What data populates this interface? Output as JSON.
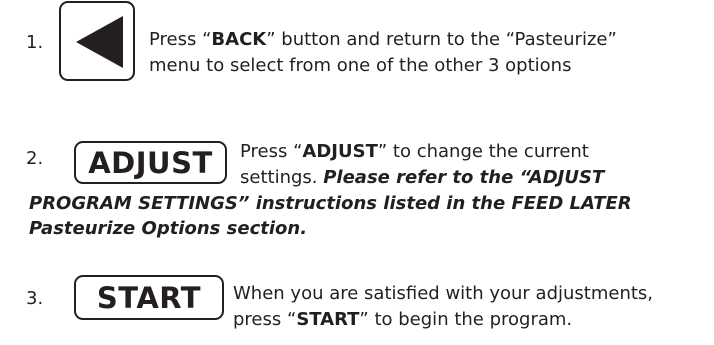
{
  "steps": [
    {
      "number": "1.",
      "button": {
        "icon": "back-triangle-icon"
      },
      "lines": [
        {
          "pre": "Press “",
          "bold": "BACK",
          "post": "” button and return to the “Pasteurize”"
        },
        {
          "text": "menu to select from one of the other 3 options"
        }
      ]
    },
    {
      "number": "2.",
      "button": {
        "label": "ADJUST"
      },
      "lines": [
        {
          "pre": "Press “",
          "bold": "ADJUST",
          "post": "” to change the current"
        },
        {
          "pre": "settings. ",
          "italic": "Please refer to the “ADJUST"
        },
        {
          "italic": "PROGRAM SETTINGS” instructions listed in the FEED LATER"
        },
        {
          "italic": "Pasteurize Options section."
        }
      ]
    },
    {
      "number": "3.",
      "button": {
        "label": "START"
      },
      "lines": [
        {
          "text": "When you are satisfied with your adjustments,"
        },
        {
          "pre": "press “",
          "bold": "START",
          "post": "” to begin the program."
        }
      ]
    }
  ]
}
